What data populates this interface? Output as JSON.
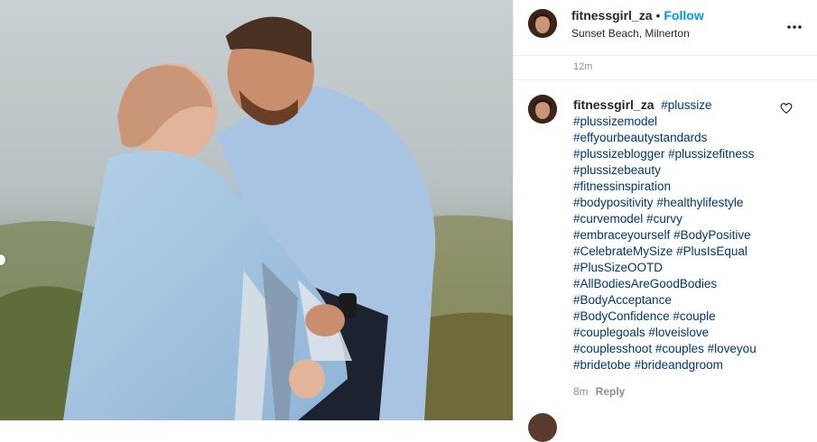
{
  "post": {
    "username": "fitnessgirl_za",
    "follow_label": "Follow",
    "separator": "•",
    "location": "Sunset Beach, Milnerton",
    "time_ago": "12m"
  },
  "caption": {
    "username": "fitnessgirl_za",
    "hashtags": [
      "#plussize",
      "#plussizemodel",
      "#effyourbeautystandards",
      "#plussizeblogger",
      "#plussizefitness",
      "#plussizebeauty",
      "#fitnessinspiration",
      "#bodypositivity",
      "#healthylifestyle",
      "#curvemodel",
      "#curvy",
      "#embraceyourself",
      "#BodyPositive",
      "#CelebrateMySize",
      "#PlusIsEqual",
      "#PlusSizeOOTD",
      "#AllBodiesAreGoodBodies",
      "#BodyAcceptance",
      "#BodyConfidence",
      "#couple",
      "#couplegoals",
      "#loveislove",
      "#couplesshoot",
      "#couples",
      "#loveyou",
      "#bridetobe",
      "#brideandgroom"
    ],
    "time_ago": "8m",
    "reply_label": "Reply"
  },
  "icons": {
    "more": "more-options-icon",
    "heart": "heart-icon"
  },
  "colors": {
    "follow": "#0095f6",
    "hashtag": "#00376b",
    "muted": "#8e8e8e"
  }
}
